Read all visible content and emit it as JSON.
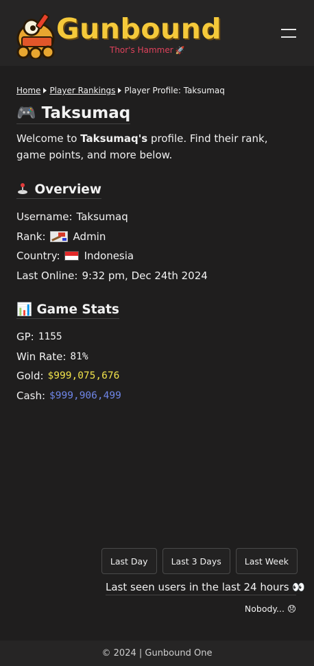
{
  "header": {
    "logo_text": "Gunbound",
    "logo_subtitle": "Thor's Hammer",
    "logo_subtitle_icon": "rocket-icon",
    "menu_icon": "hamburger-icon"
  },
  "breadcrumb": {
    "home": "Home",
    "rankings": "Player Rankings",
    "current": "Player Profile: Taksumaq"
  },
  "page": {
    "title_icon": "🎮",
    "title": "Taksumaq",
    "intro_prefix": "Welcome to ",
    "intro_name": "Taksumaq's",
    "intro_suffix": " profile. Find their rank, game points, and more below."
  },
  "overview": {
    "title_icon": "joystick-icon",
    "title": "Overview",
    "username_label": "Username:",
    "username": "Taksumaq",
    "rank_label": "Rank:",
    "rank": "Admin",
    "rank_icon": "admin-hammer-icon",
    "country_label": "Country:",
    "country": "Indonesia",
    "country_flag_colors": [
      "#e22a2a",
      "#ffffff"
    ],
    "last_online_label": "Last Online:",
    "last_online": "9:32 pm, Dec 24th 2024"
  },
  "stats": {
    "title_icon": "📊",
    "title": "Game Stats",
    "gp_label": "GP:",
    "gp": "1155",
    "winrate_label": "Win Rate:",
    "winrate": "81%",
    "gold_label": "Gold:",
    "gold": "$999,075,676",
    "gold_color": "#f0e24a",
    "cash_label": "Cash:",
    "cash": "$999,906,499",
    "cash_color": "#6f86e8"
  },
  "last_seen": {
    "buttons": [
      "Last Day",
      "Last 3 Days",
      "Last Week"
    ],
    "title": "Last seen users in the last 24 hours",
    "title_icon": "👀",
    "empty_text": "Nobody...",
    "empty_icon": "😞"
  },
  "footer": {
    "text": "© 2024 | Gunbound One"
  }
}
